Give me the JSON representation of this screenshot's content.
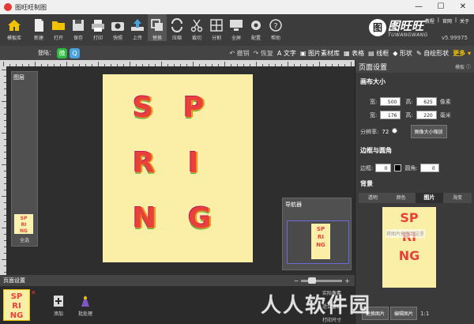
{
  "window": {
    "title": "图旺旺制图",
    "minimize": "—",
    "maximize": "☐",
    "close": "✕"
  },
  "toolbar": {
    "home_label": "模板库",
    "items": [
      {
        "label": "新建",
        "icon": "new-file-icon"
      },
      {
        "label": "打开",
        "icon": "open-folder-icon"
      },
      {
        "label": "保存",
        "icon": "save-icon"
      },
      {
        "label": "打印",
        "icon": "print-icon"
      },
      {
        "label": "快照",
        "icon": "camera-icon"
      },
      {
        "label": "上传",
        "icon": "upload-icon"
      },
      {
        "label": "替换",
        "icon": "replace-icon"
      },
      {
        "label": "压缩",
        "icon": "compress-icon"
      },
      {
        "label": "裁切",
        "icon": "scissors-icon"
      },
      {
        "label": "分割",
        "icon": "split-icon"
      },
      {
        "label": "全屏",
        "icon": "monitor-icon"
      },
      {
        "label": "配置",
        "icon": "gear-icon"
      },
      {
        "label": "帮助",
        "icon": "help-icon"
      }
    ],
    "active_index": 6
  },
  "brand": {
    "name": "图旺旺",
    "sub": "TUWANGWANG",
    "mark": "图",
    "version": "v5.99975"
  },
  "toplinks": [
    "教程",
    "官网",
    "关于"
  ],
  "secondbar": {
    "login_label": "登陆：",
    "wechat": "微",
    "qq": "Q",
    "undo": "撤销",
    "redo": "恢复",
    "text": "文字",
    "material": "图片素材库",
    "table": "表格",
    "frame": "线框",
    "shape": "形状",
    "custom_shape": "自绘形状",
    "more": "更多"
  },
  "layers": {
    "title": "图层",
    "select_all": "全选"
  },
  "canvas": {
    "letters": [
      "S",
      "P",
      "R",
      "I",
      "N",
      "G"
    ],
    "colors": {
      "background": "#fbeea6",
      "letter": "#e8403a"
    }
  },
  "navigator": {
    "title": "导航器",
    "mini_text": "SPRING"
  },
  "right_panel": {
    "title": "页面设置",
    "template_btn": "模板 ⓘ",
    "canvas_size": "画布大小",
    "width_label": "宽:",
    "height_label": "高:",
    "width_px": "500",
    "height_px": "625",
    "unit_px": "像素",
    "width_mm": "176",
    "height_mm": "220",
    "unit_mm": "毫米",
    "dpi_label": "分辨率:",
    "dpi": "72",
    "resize_btn": "图像大小缩放",
    "border_title": "边框与圆角",
    "border_label": "边框:",
    "border_value": "0",
    "corner_label": "圆角:",
    "corner_value": "0",
    "bg_title": "背景",
    "bg_tabs": [
      "透明",
      "颜色",
      "图片",
      "海变"
    ],
    "bg_active": 2,
    "bg_preview_text": "SPRING",
    "bg_hint": "将图片拖放到这里",
    "replace_btn": "更换图片",
    "edit_btn": "编辑图片",
    "ratio": "1:1"
  },
  "pagebar": {
    "title": "页面设置",
    "zoom_minus": "−",
    "zoom_plus": "+",
    "zoom_level": 0.2
  },
  "bottom": {
    "add_label": "添加",
    "batch_label": "批处理",
    "page_text": "SPRING"
  },
  "popup": {
    "actual": "实际像素",
    "fit": "适合窗口",
    "print": "打印尺寸"
  },
  "watermark": "人人软件园"
}
